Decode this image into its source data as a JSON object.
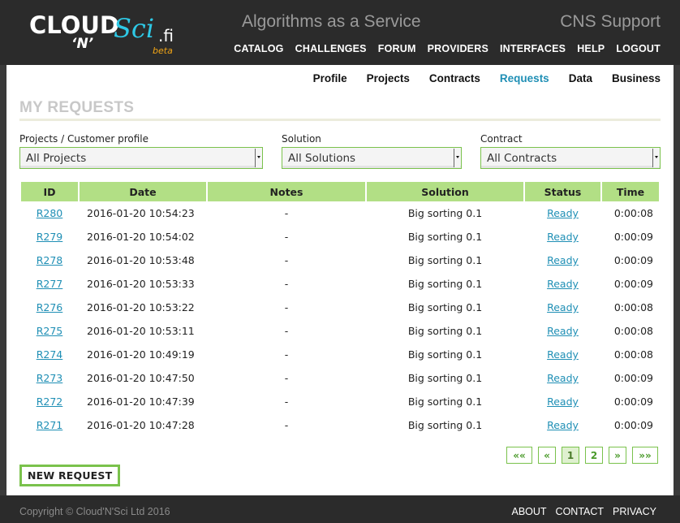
{
  "header": {
    "logo": {
      "w1": "CLOUD",
      "w2": "‘N’",
      "w3": "Sci",
      "w4": ".fi",
      "w5": "beta"
    },
    "tagline": "Algorithms as a Service",
    "support": "CNS Support",
    "nav": [
      "CATALOG",
      "CHALLENGES",
      "FORUM",
      "PROVIDERS",
      "INTERFACES",
      "HELP",
      "LOGOUT"
    ]
  },
  "subnav": {
    "items": [
      "Profile",
      "Projects",
      "Contracts",
      "Requests",
      "Data",
      "Business"
    ],
    "active": "Requests"
  },
  "page_title": "MY REQUESTS",
  "filters": {
    "projects": {
      "label": "Projects / Customer profile",
      "value": "All Projects"
    },
    "solution": {
      "label": "Solution",
      "value": "All Solutions"
    },
    "contract": {
      "label": "Contract",
      "value": "All Contracts"
    }
  },
  "table": {
    "headers": [
      "ID",
      "Date",
      "Notes",
      "Solution",
      "Status",
      "Time"
    ],
    "rows": [
      {
        "id": "R280",
        "date": "2016-01-20 10:54:23",
        "notes": "-",
        "solution": "Big sorting 0.1",
        "status": "Ready",
        "time": "0:00:08"
      },
      {
        "id": "R279",
        "date": "2016-01-20 10:54:02",
        "notes": "-",
        "solution": "Big sorting 0.1",
        "status": "Ready",
        "time": "0:00:09"
      },
      {
        "id": "R278",
        "date": "2016-01-20 10:53:48",
        "notes": "-",
        "solution": "Big sorting 0.1",
        "status": "Ready",
        "time": "0:00:09"
      },
      {
        "id": "R277",
        "date": "2016-01-20 10:53:33",
        "notes": "-",
        "solution": "Big sorting 0.1",
        "status": "Ready",
        "time": "0:00:09"
      },
      {
        "id": "R276",
        "date": "2016-01-20 10:53:22",
        "notes": "-",
        "solution": "Big sorting 0.1",
        "status": "Ready",
        "time": "0:00:08"
      },
      {
        "id": "R275",
        "date": "2016-01-20 10:53:11",
        "notes": "-",
        "solution": "Big sorting 0.1",
        "status": "Ready",
        "time": "0:00:08"
      },
      {
        "id": "R274",
        "date": "2016-01-20 10:49:19",
        "notes": "-",
        "solution": "Big sorting 0.1",
        "status": "Ready",
        "time": "0:00:08"
      },
      {
        "id": "R273",
        "date": "2016-01-20 10:47:50",
        "notes": "-",
        "solution": "Big sorting 0.1",
        "status": "Ready",
        "time": "0:00:09"
      },
      {
        "id": "R272",
        "date": "2016-01-20 10:47:39",
        "notes": "-",
        "solution": "Big sorting 0.1",
        "status": "Ready",
        "time": "0:00:09"
      },
      {
        "id": "R271",
        "date": "2016-01-20 10:47:28",
        "notes": "-",
        "solution": "Big sorting 0.1",
        "status": "Ready",
        "time": "0:00:09"
      }
    ]
  },
  "pagination": {
    "first": "««",
    "prev": "«",
    "pages": [
      "1",
      "2"
    ],
    "current": "1",
    "next": "»",
    "last": "»»"
  },
  "new_request_label": "NEW REQUEST",
  "footer": {
    "copyright": "Copyright © Cloud'N'Sci Ltd 2016",
    "links": [
      "ABOUT",
      "CONTACT",
      "PRIVACY"
    ]
  },
  "colors": {
    "accent_green": "#7ac24c",
    "header_green": "#b2df85",
    "link_blue": "#1f8fb5",
    "logo_cyan": "#2ec9e6",
    "logo_orange": "#f2a516"
  }
}
